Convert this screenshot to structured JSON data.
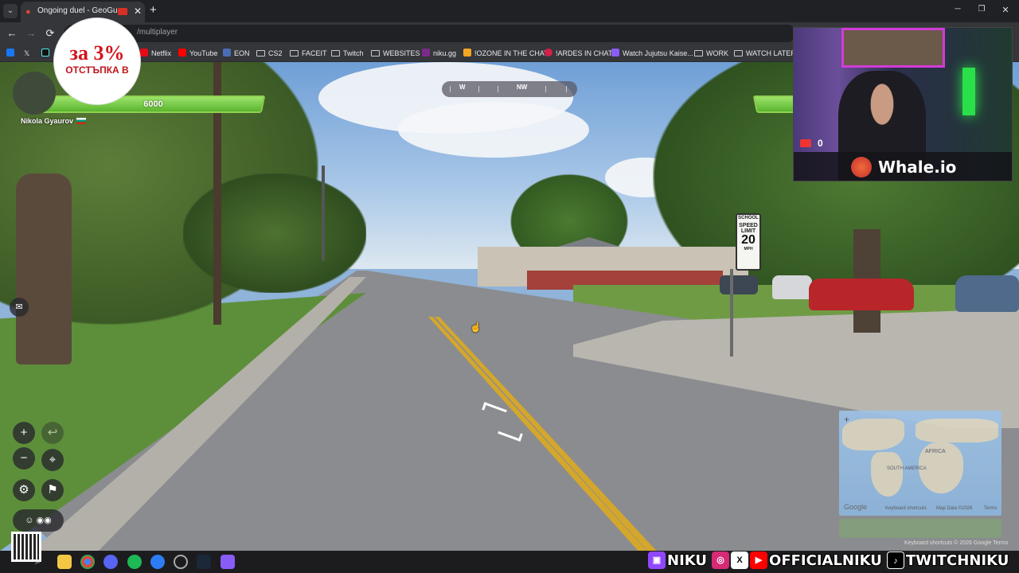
{
  "browser": {
    "tab_title": "Ongoing duel - GeoGuessr",
    "url": "/multiplayer",
    "bookmarks": [
      {
        "label": "Netflix",
        "kind": "site"
      },
      {
        "label": "YouTube",
        "kind": "site"
      },
      {
        "label": "EON",
        "kind": "site"
      },
      {
        "label": "CS2",
        "kind": "folder"
      },
      {
        "label": "FACEIT",
        "kind": "folder"
      },
      {
        "label": "Twitch",
        "kind": "folder"
      },
      {
        "label": "WEBSITES",
        "kind": "folder"
      },
      {
        "label": "niku.gg",
        "kind": "site"
      },
      {
        "label": "!OZONE IN THE CHAT",
        "kind": "site"
      },
      {
        "label": "!ARDES IN CHAT",
        "kind": "site"
      },
      {
        "label": "Watch Jujutsu Kaise...",
        "kind": "site"
      },
      {
        "label": "WORK",
        "kind": "folder"
      },
      {
        "label": "WATCH LATER",
        "kind": "folder"
      }
    ]
  },
  "promo": {
    "line1": "за 3%",
    "line2": "ОТСТЪПКА В"
  },
  "game": {
    "player_name": "Nikola Gyaurov",
    "player_health": "6000",
    "compass": {
      "west": "W",
      "northwest": "NW"
    },
    "sign": {
      "top": "SCHOOL",
      "line": "SPEED LIMIT",
      "value": "20",
      "unit": "MPH"
    }
  },
  "minimap": {
    "google": "Google",
    "shortcuts": "Keyboard shortcuts",
    "map_data": "Map Data ©2026",
    "terms": "Terms",
    "label_africa": "AFRICA",
    "label_south_america": "SOUTH AMERICA",
    "footer": "Keyboard shortcuts  © 2026 Google  Terms"
  },
  "stream": {
    "stat_value": "0",
    "brand": "Whale.io",
    "socials": [
      "NIKU",
      "OFFICIALNIKU",
      "TWITCHNIKU"
    ]
  }
}
